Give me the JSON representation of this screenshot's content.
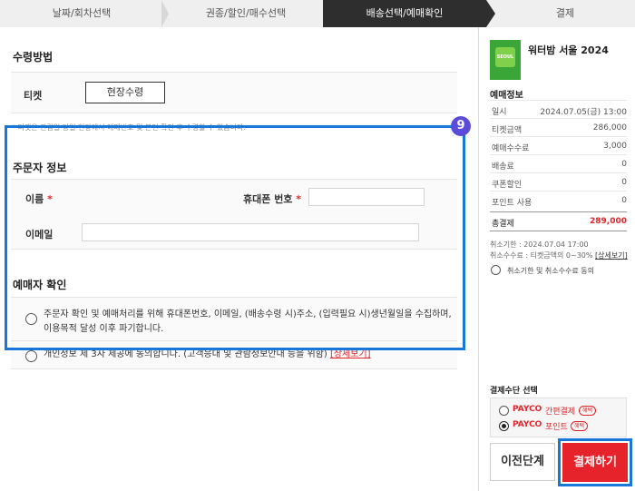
{
  "steps": [
    {
      "label": "날짜/회차선택"
    },
    {
      "label": "권종/할인/매수선택"
    },
    {
      "label": "배송선택/예매확인"
    },
    {
      "label": "결제"
    }
  ],
  "receive": {
    "title": "수령방법",
    "ticket_label": "티켓",
    "pickup_button": "현장수령",
    "note": "* 티켓은 관람일 당일 현장에서 예매번호 및 본인 확인 후 수령할 수 있습니다."
  },
  "orderer": {
    "title": "주문자 정보",
    "name_label": "이름",
    "phone_label": "휴대폰 번호",
    "email_label": "이메일",
    "required_mark": "*",
    "badge": "9"
  },
  "buyer_check": {
    "title": "예매자 확인",
    "agree1_line1": "주문자 확인 및 예매처리를 위해 휴대폰번호, 이메일, (배송수령 시)주소, (입력필요 시)생년월일을 수집하며,",
    "agree1_line2": "이용목적 달성 이후 파기합니다.",
    "agree2_text": "개인정보 제 3자 제공에 동의합니다. (고객응대 및 관람정보안내 등을 위함)",
    "agree2_link": "[상세보기]"
  },
  "sidebar": {
    "poster_text": "SEOUL",
    "show_title": "워터밤 서울 2024",
    "info_title": "예매정보",
    "rows": [
      {
        "k": "일시",
        "v": "2024.07.05(금) 13:00"
      },
      {
        "k": "티켓금액",
        "v": "286,000"
      },
      {
        "k": "예매수수료",
        "v": "3,000"
      },
      {
        "k": "배송료",
        "v": "0"
      },
      {
        "k": "쿠폰할인",
        "v": "0"
      },
      {
        "k": "포인트 사용",
        "v": "0"
      }
    ],
    "total_label": "총결제",
    "total_value": "289,000",
    "cancel_deadline": "취소기한 : 2024.07.04 17:00",
    "cancel_fee": "취소수수료 : 티켓금액의 0~30%",
    "cancel_fee_link": "[상세보기]",
    "cancel_agree": "취소기한 및 취소수수료 동의",
    "pay_title": "결제수단 선택",
    "pay_options": [
      {
        "brand": "PAYCO",
        "desc": "간편결제",
        "badge": "혜택"
      },
      {
        "brand": "PAYCO",
        "desc": "포인트",
        "badge": "혜택"
      }
    ],
    "prev_button": "이전단계",
    "pay_button": "결제하기"
  },
  "colors": {
    "accent_red": "#e6232a",
    "highlight_blue": "#1877d8",
    "active_step": "#2e2e2e"
  }
}
